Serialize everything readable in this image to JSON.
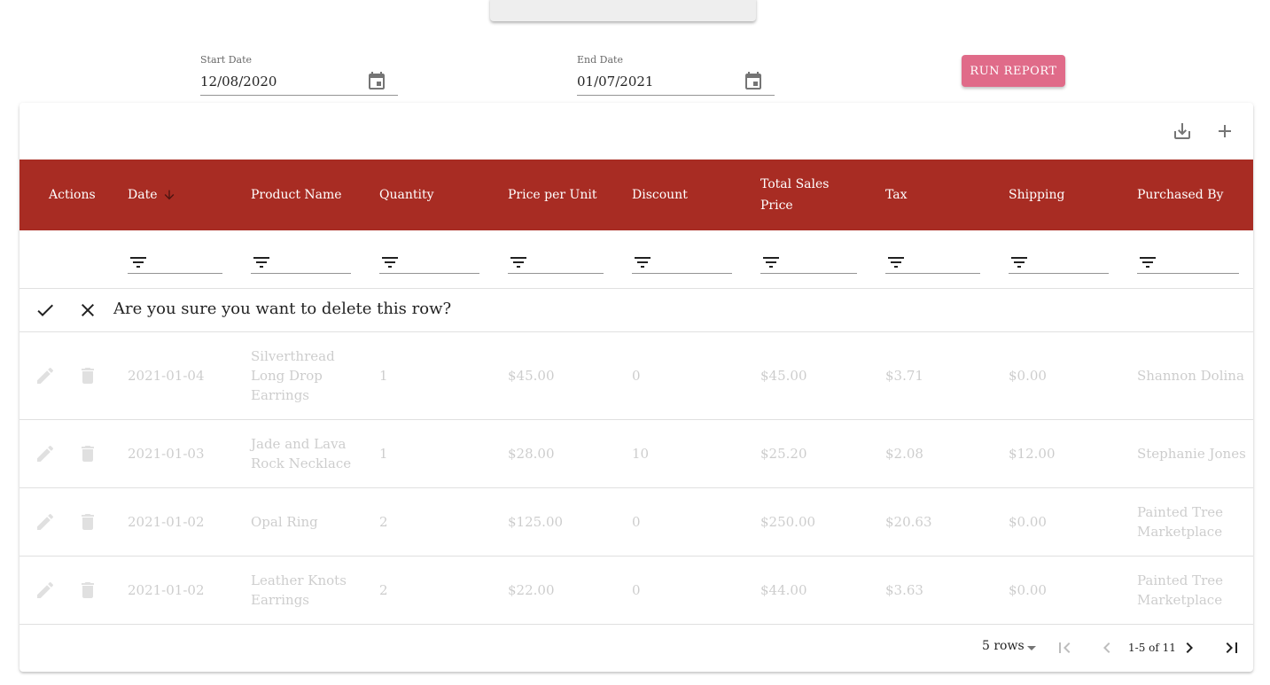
{
  "filters": {
    "start_date": {
      "label": "Start Date",
      "value": "12/08/2020"
    },
    "end_date": {
      "label": "End Date",
      "value": "01/07/2021"
    },
    "run_report_label": "RUN REPORT"
  },
  "colors": {
    "header_bg": "#a82c23",
    "accent_button": "#e06b89"
  },
  "toolbar": {
    "icons": [
      "download-icon",
      "add-icon"
    ]
  },
  "table": {
    "columns": [
      "Actions",
      "Date",
      "Product Name",
      "Quantity",
      "Price per Unit",
      "Discount",
      "Total Sales Price",
      "Tax",
      "Shipping",
      "Purchased By"
    ],
    "sort_column": "Date",
    "sort_direction": "descending",
    "confirm_message": "Are you sure you want to delete this row?",
    "rows": [
      [
        "2021-01-04",
        "Silverthread Long Drop Earrings",
        "1",
        "$45.00",
        "0",
        "$45.00",
        "$3.71",
        "$0.00",
        "Shannon Dolina"
      ],
      [
        "2021-01-03",
        "Jade and Lava Rock Necklace",
        "1",
        "$28.00",
        "10",
        "$25.20",
        "$2.08",
        "$12.00",
        "Stephanie Jones"
      ],
      [
        "2021-01-02",
        "Opal Ring",
        "2",
        "$125.00",
        "0",
        "$250.00",
        "$20.63",
        "$0.00",
        "Painted Tree Marketplace"
      ],
      [
        "2021-01-02",
        "Leather Knots Earrings",
        "2",
        "$22.00",
        "0",
        "$44.00",
        "$3.63",
        "$0.00",
        "Painted Tree Marketplace"
      ]
    ]
  },
  "pagination": {
    "rows_per_page": "5 rows",
    "range": "1-5 of 11"
  }
}
